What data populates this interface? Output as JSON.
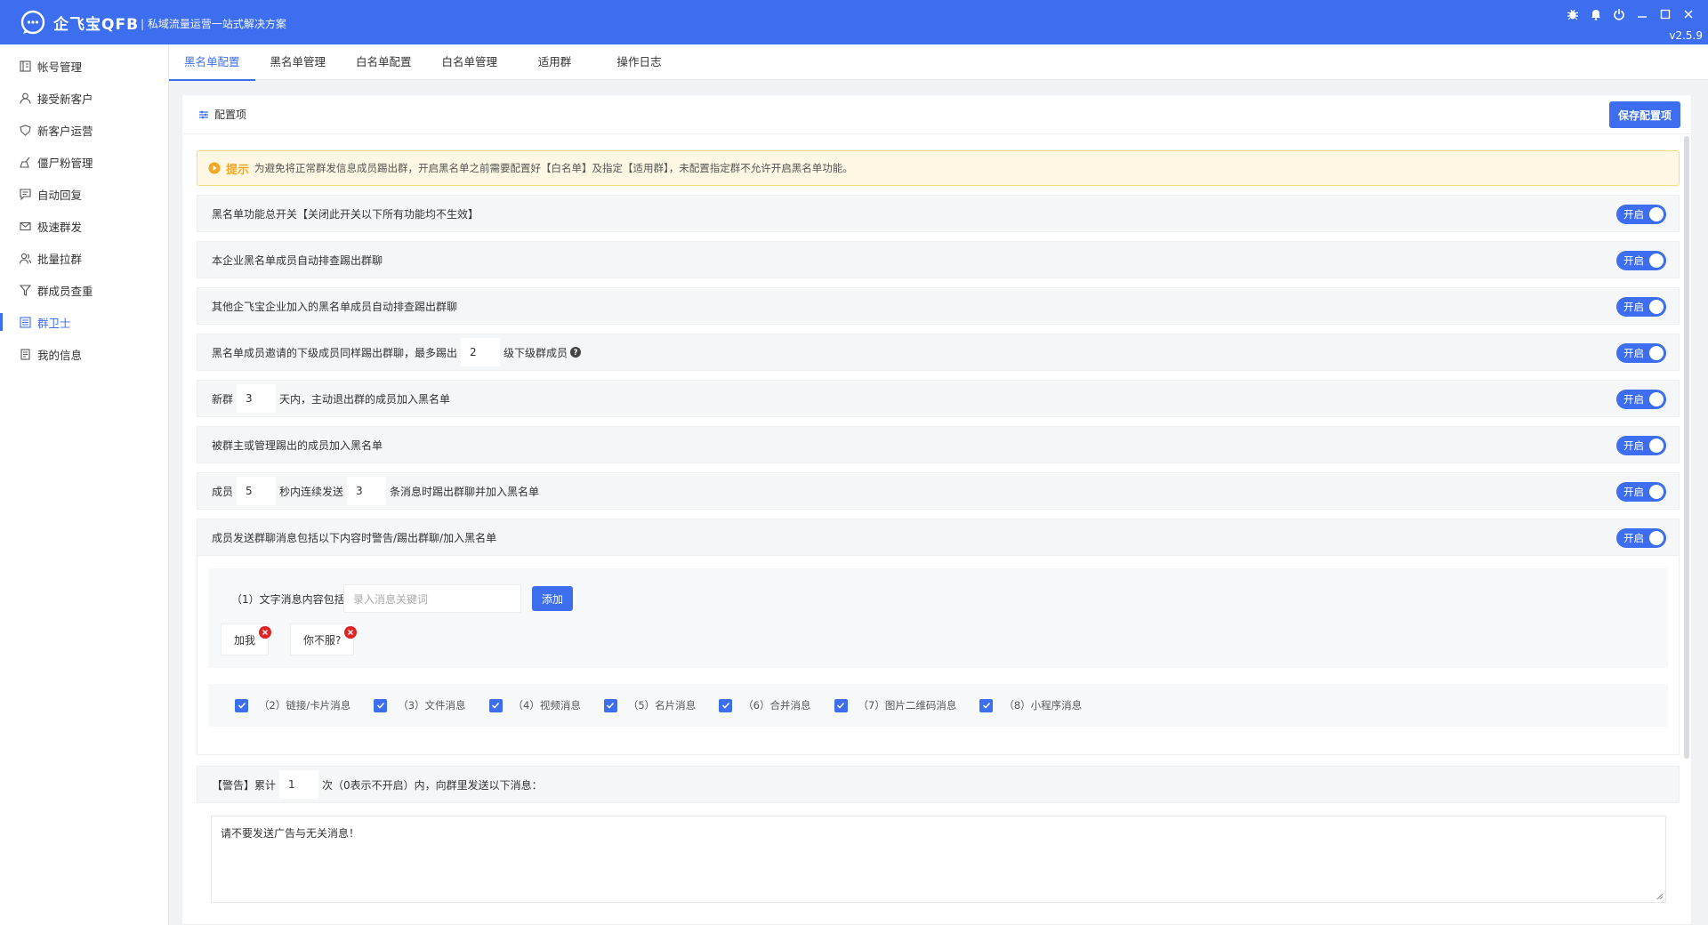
{
  "titlebar": {
    "app_name": "企飞宝QFB",
    "slogan": "| 私域流量运营一站式解决方案",
    "version": "v2.5.9",
    "brand_color": "#3d6ef0"
  },
  "sidebar": {
    "items": [
      {
        "label": "帐号管理",
        "icon": "account-icon"
      },
      {
        "label": "接受新客户",
        "icon": "user-icon"
      },
      {
        "label": "新客户运营",
        "icon": "shield-icon"
      },
      {
        "label": "僵尸粉管理",
        "icon": "broom-icon"
      },
      {
        "label": "自动回复",
        "icon": "chat-icon"
      },
      {
        "label": "极速群发",
        "icon": "mail-icon"
      },
      {
        "label": "批量拉群",
        "icon": "users-icon"
      },
      {
        "label": "群成员查重",
        "icon": "filter-icon"
      },
      {
        "label": "群卫士",
        "icon": "guard-icon",
        "active": true
      },
      {
        "label": "我的信息",
        "icon": "doc-icon"
      }
    ]
  },
  "tabs": [
    "黑名单配置",
    "黑名单管理",
    "白名单配置",
    "白名单管理",
    "适用群",
    "操作日志"
  ],
  "panel": {
    "title": "配置项",
    "save_label": "保存配置项"
  },
  "notice": {
    "label": "提示",
    "text": "为避免将正常群发信息成员踢出群，开启黑名单之前需要配置好【白名单】及指定【适用群】，未配置指定群不允许开启黑名单功能。"
  },
  "toggle_label": "开启",
  "rows": {
    "r1": "黑名单功能总开关【关闭此开关以下所有功能均不生效】",
    "r2": "本企业黑名单成员自动排查踢出群聊",
    "r3": "其他企飞宝企业加入的黑名单成员自动排查踢出群聊",
    "r4_a": "黑名单成员邀请的下级成员同样踢出群聊，最多踢出",
    "r4_val": "2",
    "r4_b": "级下级群成员",
    "r5_a": "新群",
    "r5_val": "3",
    "r5_b": "天内，主动退出群的成员加入黑名单",
    "r6": "被群主或管理踢出的成员加入黑名单",
    "r7_a": "成员",
    "r7_val1": "5",
    "r7_b": "秒内连续发送",
    "r7_val2": "3",
    "r7_c": "条消息时踢出群聊并加入黑名单",
    "r8": "成员发送群聊消息包括以下内容时警告/踢出群聊/加入黑名单"
  },
  "keywords": {
    "label": "（1）文字消息内容包括",
    "placeholder": "录入消息关键词",
    "add_label": "添加",
    "tags": [
      "加我",
      "你不服?"
    ]
  },
  "checks": [
    "（2）链接/卡片消息",
    "（3）文件消息",
    "（4）视频消息",
    "（5）名片消息",
    "（6）合并消息",
    "（7）图片二维码消息",
    "（8）小程序消息"
  ],
  "warn": {
    "a": "【警告】累计",
    "val": "1",
    "b": "次（0表示不开启）内，向群里发送以下消息：",
    "message": "请不要发送广告与无关消息！"
  }
}
